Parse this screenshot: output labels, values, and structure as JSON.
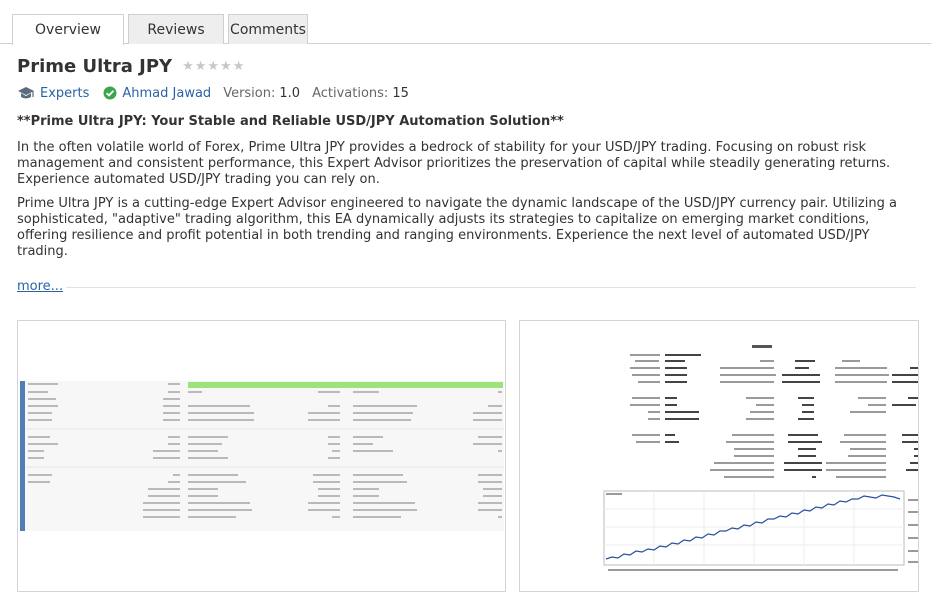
{
  "tabs": [
    {
      "label": "Overview",
      "active": true
    },
    {
      "label": "Reviews",
      "active": false
    },
    {
      "label": "Comments",
      "active": false
    }
  ],
  "product": {
    "title": "Prime Ultra JPY",
    "rating_stars": 0,
    "category": "Experts",
    "author": "Ahmad Jawad",
    "version_label": "Version:",
    "version": "1.0",
    "activations_label": "Activations:",
    "activations": "15"
  },
  "description": {
    "headline": "**Prime Ultra JPY: Your Stable and Reliable USD/JPY Automation Solution**",
    "paragraph1": "In the often volatile world of Forex, Prime Ultra JPY provides a bedrock of stability for your USD/JPY trading. Focusing on robust risk management and consistent performance, this Expert Advisor prioritizes the preservation of capital while steadily generating returns. Experience automated USD/JPY trading you can rely on.",
    "paragraph2": "Prime Ultra JPY is a cutting-edge Expert Advisor engineered to navigate the dynamic landscape of the USD/JPY currency pair. Utilizing a sophisticated, \"adaptive\" trading algorithm, this EA dynamically adjusts its strategies to capitalize on emerging market conditions, offering resilience and profit potential in both trending and ranging environments. Experience the next level of automated USD/JPY trading.",
    "more_label": "more..."
  },
  "colors": {
    "link": "#2b62a7",
    "check_green": "#3aa84a",
    "history_bar": "#9be37a",
    "report_sidebar": "#4f7fb5",
    "chart_line": "#2a4f9e"
  },
  "icons": {
    "category": "graduation-cap-icon",
    "author": "verified-check-icon",
    "rating": "star-icon"
  },
  "screenshots": [
    {
      "name": "backtest-report-table"
    },
    {
      "name": "backtest-results-with-balance-chart"
    }
  ]
}
